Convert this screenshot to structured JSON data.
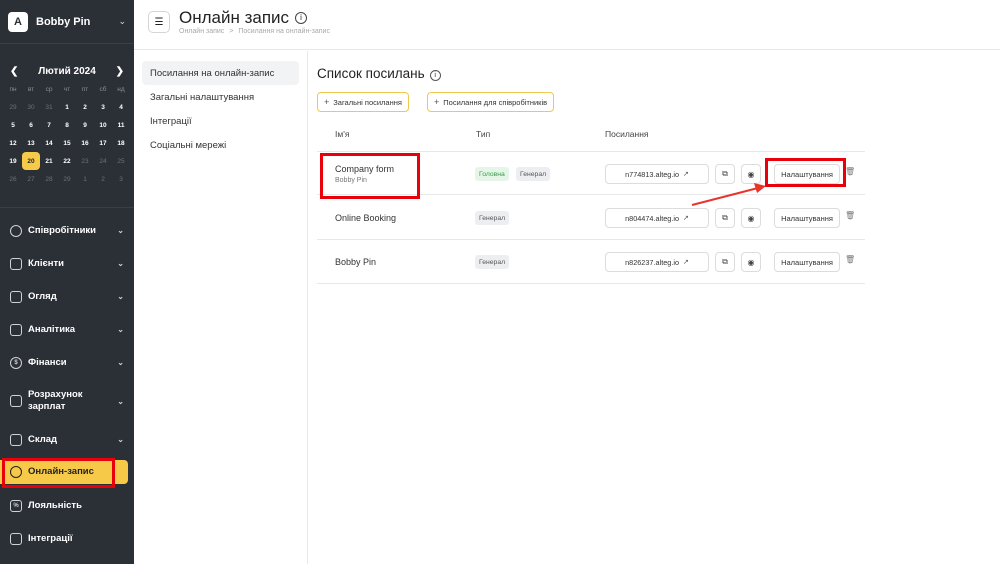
{
  "brand": {
    "name": "Bobby Pin",
    "logo": "A"
  },
  "calendar": {
    "month": "Лютий 2024",
    "weekdays": [
      "пн",
      "вт",
      "ср",
      "чт",
      "пт",
      "сб",
      "нд"
    ],
    "days": [
      {
        "d": "29",
        "o": true
      },
      {
        "d": "30",
        "o": true
      },
      {
        "d": "31",
        "o": true
      },
      {
        "d": "1"
      },
      {
        "d": "2"
      },
      {
        "d": "3"
      },
      {
        "d": "4"
      },
      {
        "d": "5"
      },
      {
        "d": "6"
      },
      {
        "d": "7"
      },
      {
        "d": "8"
      },
      {
        "d": "9"
      },
      {
        "d": "10"
      },
      {
        "d": "11"
      },
      {
        "d": "12"
      },
      {
        "d": "13"
      },
      {
        "d": "14"
      },
      {
        "d": "15"
      },
      {
        "d": "16"
      },
      {
        "d": "17"
      },
      {
        "d": "18"
      },
      {
        "d": "19"
      },
      {
        "d": "20",
        "today": true
      },
      {
        "d": "21"
      },
      {
        "d": "22"
      },
      {
        "d": "23",
        "o": true
      },
      {
        "d": "24",
        "o": true
      },
      {
        "d": "25",
        "o": true
      },
      {
        "d": "26",
        "o": true
      },
      {
        "d": "27",
        "o": true
      },
      {
        "d": "28",
        "o": true
      },
      {
        "d": "29",
        "o": true
      },
      {
        "d": "1",
        "o": true
      },
      {
        "d": "2",
        "o": true
      },
      {
        "d": "3",
        "o": true
      }
    ]
  },
  "nav": {
    "staff": "Співробітники",
    "clients": "Клієнти",
    "overview": "Огляд",
    "analytics": "Аналітика",
    "finance": "Фінанси",
    "payroll": "Розрахунок зарплат",
    "warehouse": "Склад",
    "online": "Онлайн-запис",
    "loyalty": "Лояльність",
    "integrations": "Інтеграції"
  },
  "header": {
    "title": "Онлайн запис",
    "crumb1": "Онлайн запис",
    "crumb_sep": ">",
    "crumb2": "Посилання на онлайн-запис"
  },
  "submenu": {
    "links": "Посилання на онлайн-запис",
    "general": "Загальні налаштування",
    "integrations": "Інтеграції",
    "social": "Соціальні мережі"
  },
  "main": {
    "title": "Список посилань",
    "btn_general": "Загальні посилання",
    "btn_staff": "Посилання для співробітників",
    "col_name": "Ім'я",
    "col_type": "Тип",
    "col_links": "Посилання",
    "settings_label": "Налаштування",
    "rows": [
      {
        "name": "Company form",
        "sub": "Bobby Pin",
        "tag1": "Головна",
        "tag2": "Генерал",
        "link": "n774813.alteg.io"
      },
      {
        "name": "Online Booking",
        "tag2": "Генерал",
        "link": "n804474.alteg.io"
      },
      {
        "name": "Bobby Pin",
        "tag2": "Генерал",
        "link": "n826237.alteg.io"
      }
    ]
  },
  "colors": {
    "accent": "#f7c948",
    "sidebar": "#2b2f36",
    "highlight": "#e8000b"
  }
}
